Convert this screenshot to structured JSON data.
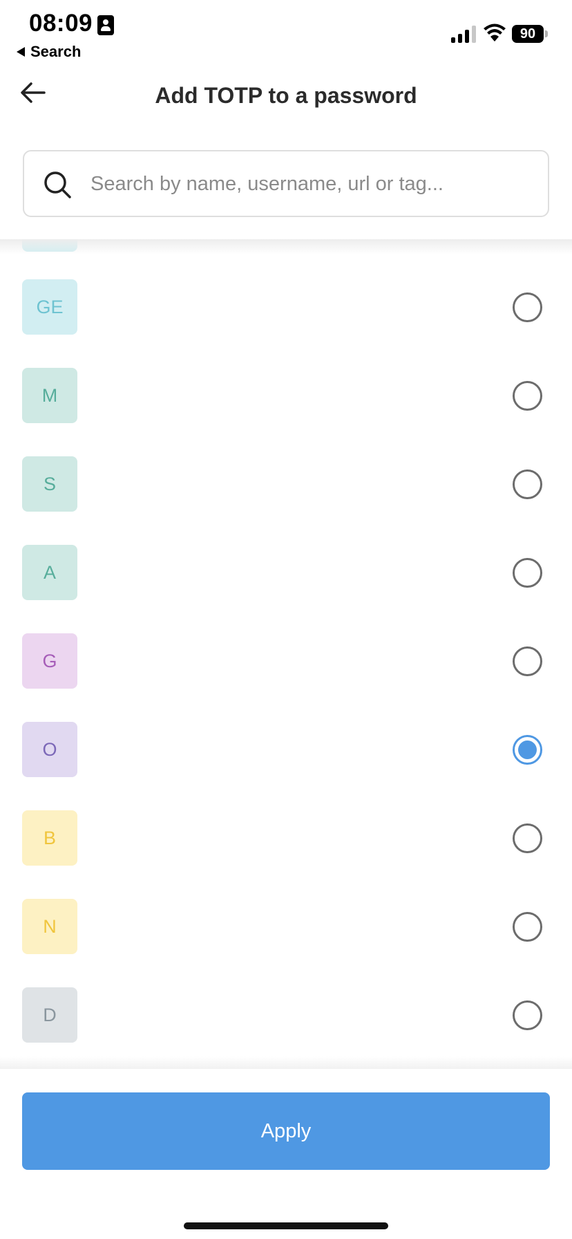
{
  "status_bar": {
    "time": "08:09",
    "back_app_label": "Search",
    "battery_level": "90",
    "signal_bars_active": 3
  },
  "header": {
    "title": "Add TOTP to a password",
    "back_icon": "arrow-left-icon"
  },
  "search": {
    "placeholder": "Search by name, username, url or tag...",
    "value": "",
    "icon": "search-icon"
  },
  "items": [
    {
      "initials": "GE",
      "bg": "#d2eef2",
      "fg": "#6ec3d1",
      "selected": false
    },
    {
      "initials": "M",
      "bg": "#cfe9e4",
      "fg": "#57ad9b",
      "selected": false
    },
    {
      "initials": "S",
      "bg": "#cfe9e4",
      "fg": "#57ad9b",
      "selected": false
    },
    {
      "initials": "A",
      "bg": "#cfe9e4",
      "fg": "#57ad9b",
      "selected": false
    },
    {
      "initials": "G",
      "bg": "#ecd6f0",
      "fg": "#a65db8",
      "selected": false
    },
    {
      "initials": "O",
      "bg": "#e1d9f1",
      "fg": "#7c68b8",
      "selected": true
    },
    {
      "initials": "B",
      "bg": "#fdf1c3",
      "fg": "#f0c53d",
      "selected": false
    },
    {
      "initials": "N",
      "bg": "#fdf1c3",
      "fg": "#f0c53d",
      "selected": false
    },
    {
      "initials": "D",
      "bg": "#dfe3e6",
      "fg": "#8a969e",
      "selected": false
    }
  ],
  "footer": {
    "apply_label": "Apply"
  },
  "colors": {
    "accent": "#4f98e3",
    "radio_border": "#6c6c6c"
  }
}
